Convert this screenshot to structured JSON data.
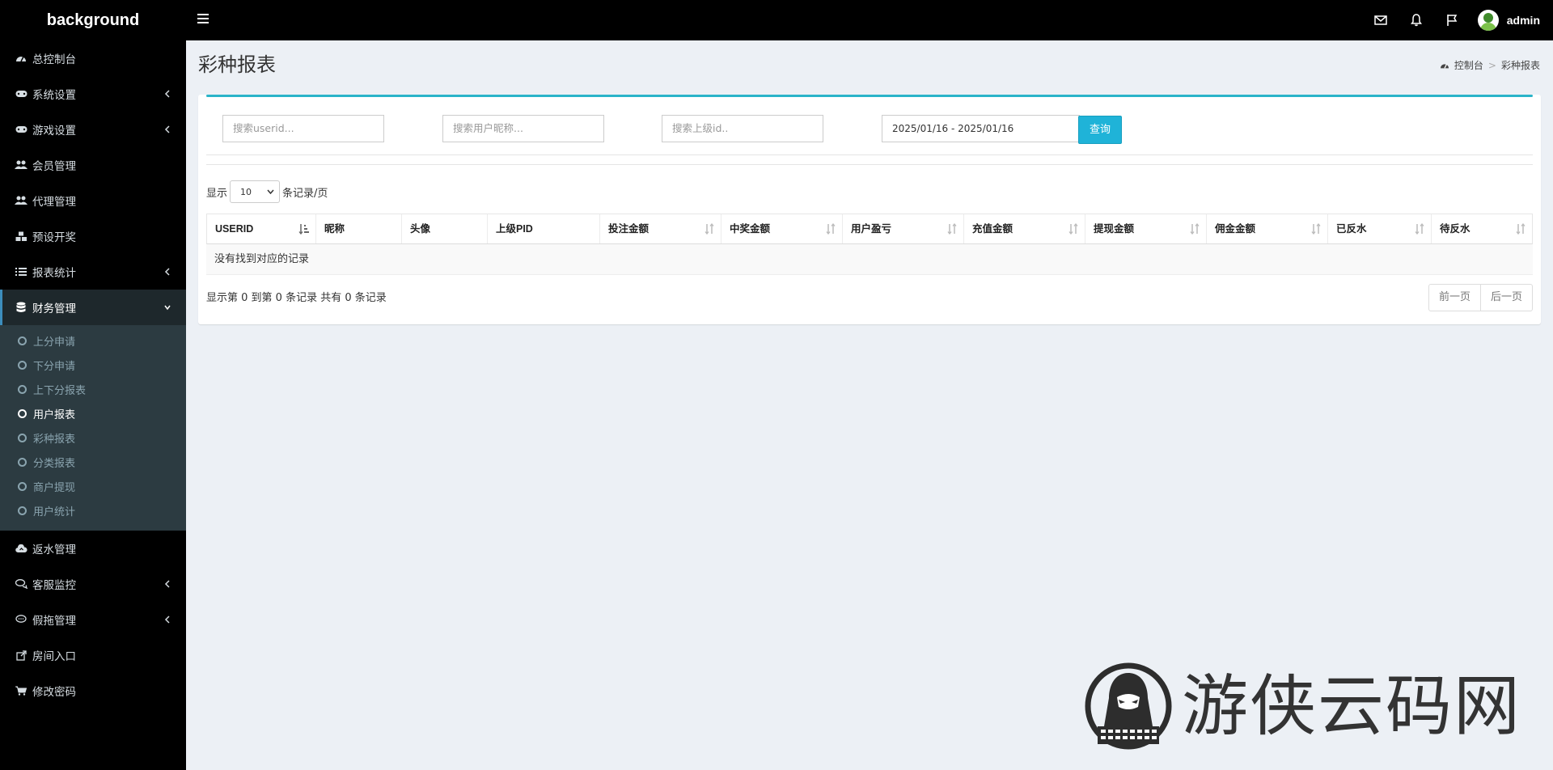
{
  "topbar": {
    "brand": "background",
    "user_name": "admin"
  },
  "sidebar": {
    "items": [
      {
        "label": "总控制台",
        "icon": "dashboard-icon",
        "has_arrow": false
      },
      {
        "label": "系统设置",
        "icon": "gamepad-icon",
        "has_arrow": true
      },
      {
        "label": "游戏设置",
        "icon": "gamepad-icon",
        "has_arrow": true
      },
      {
        "label": "会员管理",
        "icon": "users-icon",
        "has_arrow": false
      },
      {
        "label": "代理管理",
        "icon": "users-icon",
        "has_arrow": false
      },
      {
        "label": "预设开奖",
        "icon": "cubes-icon",
        "has_arrow": false
      },
      {
        "label": "报表统计",
        "icon": "list-icon",
        "has_arrow": true
      },
      {
        "label": "财务管理",
        "icon": "database-icon",
        "has_arrow": true,
        "expanded": true
      },
      {
        "label": "返水管理",
        "icon": "cloud-upload-icon",
        "has_arrow": false
      },
      {
        "label": "客服监控",
        "icon": "comments-icon",
        "has_arrow": true
      },
      {
        "label": "假拖管理",
        "icon": "comment-icon",
        "has_arrow": true
      },
      {
        "label": "房间入口",
        "icon": "external-link-icon",
        "has_arrow": false
      },
      {
        "label": "修改密码",
        "icon": "cart-icon",
        "has_arrow": false
      }
    ],
    "finance_sub": [
      {
        "label": "上分申请"
      },
      {
        "label": "下分申请"
      },
      {
        "label": "上下分报表"
      },
      {
        "label": "用户报表",
        "current": true
      },
      {
        "label": "彩种报表"
      },
      {
        "label": "分类报表"
      },
      {
        "label": "商户提现"
      },
      {
        "label": "用户统计"
      }
    ]
  },
  "header": {
    "title": "彩种报表",
    "breadcrumb": [
      "控制台",
      "彩种报表"
    ],
    "breadcrumb_sep": ">"
  },
  "filters": {
    "userid_placeholder": "搜索userid...",
    "nickname_placeholder": "搜索用户昵称...",
    "parent_placeholder": "搜索上级id..",
    "date_range": "2025/01/16 - 2025/01/16",
    "query_label": "查询"
  },
  "paging": {
    "show_label": "显示",
    "page_size": "10",
    "per_page_label": "条记录/页",
    "info": "显示第 0 到第 0 条记录 共有 0 条记录",
    "prev": "前一页",
    "next": "后一页"
  },
  "table": {
    "columns": [
      "USERID",
      "昵称",
      "头像",
      "上级PID",
      "投注金额",
      "中奖金额",
      "用户盈亏",
      "充值金额",
      "提现金额",
      "佣金金额",
      "已反水",
      "待反水"
    ],
    "empty_text": "没有找到对应的记录"
  },
  "watermark": {
    "text": "游侠云码网"
  },
  "colors": {
    "accent": "#2ab4c9",
    "query_button": "#1fb3d8",
    "sidebar_bg": "#000000",
    "submenu_bg": "#2c3b41"
  }
}
